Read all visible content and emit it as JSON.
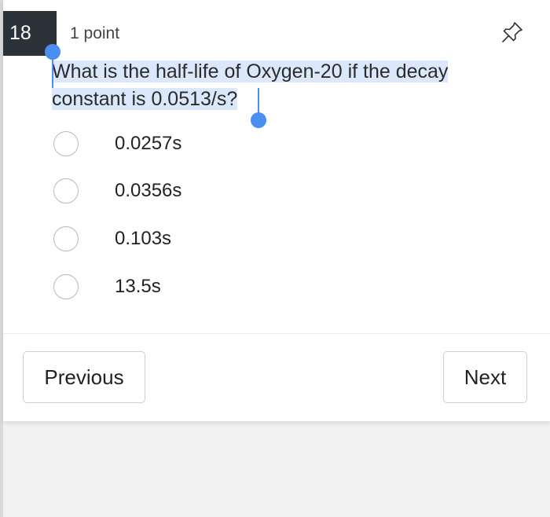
{
  "question": {
    "number": "18",
    "points": "1 point",
    "text_line1": "What is the half-life of Oxygen-20 if the decay",
    "text_line2": "constant is 0.0513/s?"
  },
  "options": [
    {
      "label": "0.0257s",
      "selected": false
    },
    {
      "label": "0.0356s",
      "selected": false
    },
    {
      "label": "0.103s",
      "selected": false
    },
    {
      "label": "13.5s",
      "selected": false
    }
  ],
  "navigation": {
    "previous_label": "Previous",
    "next_label": "Next"
  },
  "icons": {
    "pin": "pushpin-icon"
  },
  "colors": {
    "number_badge_bg": "#2c3338",
    "selection_highlight": "#dbe8fb",
    "selection_handle": "#4a8ff0"
  }
}
